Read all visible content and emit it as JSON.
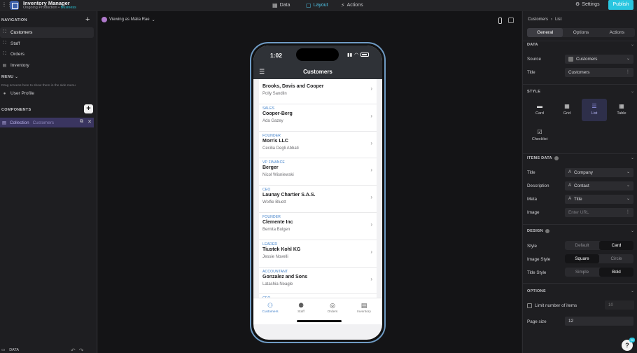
{
  "app": {
    "title": "Inventory Manager",
    "subtitle": "Ongoing Production • ",
    "plan": "Business"
  },
  "topnav": {
    "data": "Data",
    "layout": "Layout",
    "actions": "Actions",
    "settings": "Settings",
    "publish": "Publish"
  },
  "left": {
    "navigation_head": "NAVIGATION",
    "nav_items": [
      "Customers",
      "Staff",
      "Orders",
      "Inventory"
    ],
    "menu_head": "MENU",
    "menu_hint": "Drag screens here to show them in the side menu",
    "menu_items": [
      "User Profile"
    ],
    "components_head": "COMPONENTS",
    "component": {
      "name": "Collection",
      "source": "Customers"
    },
    "footer": "DATA"
  },
  "canvas": {
    "viewing_as": "Viewing as Malia Rae"
  },
  "phone": {
    "time": "1:02",
    "header_title": "Customers",
    "rows": [
      {
        "meta": "",
        "title": "Brooks, Davis and Cooper",
        "desc": "Polly Sandlin"
      },
      {
        "meta": "SALES",
        "title": "Cooper-Berg",
        "desc": "Ada Gazey"
      },
      {
        "meta": "FOUNDER",
        "title": "Morris LLC",
        "desc": "Cecilia Degli Abbati"
      },
      {
        "meta": "VP FINANCE",
        "title": "Berger",
        "desc": "Nicol Wisniewski"
      },
      {
        "meta": "CEO",
        "title": "Launay Chartier S.A.S.",
        "desc": "Wolfie Bluett"
      },
      {
        "meta": "FOUNDER",
        "title": "Clemente Inc",
        "desc": "Bernita Bulgen"
      },
      {
        "meta": "LEADER",
        "title": "Tiustek Kohl KG",
        "desc": "Jessie Novelli"
      },
      {
        "meta": "ACCOUNTANT",
        "title": "Gonzalez and Sons",
        "desc": "Latashia Neagle"
      },
      {
        "meta": "CEO",
        "title": "",
        "desc": ""
      }
    ],
    "tabs": [
      "Customers",
      "Staff",
      "Orders",
      "Inventory"
    ]
  },
  "right": {
    "crumb": [
      "Customers",
      "›",
      "List"
    ],
    "tabs": [
      "General",
      "Options",
      "Actions"
    ],
    "data_head": "DATA",
    "source_label": "Source",
    "source_value": "Customers",
    "title_label": "Title",
    "title_value": "Customers",
    "style_head": "STYLE",
    "style_options": [
      "Card",
      "Grid",
      "List",
      "Table",
      "Checklist"
    ],
    "items_head": "ITEMS DATA",
    "item_title_label": "Title",
    "item_title_value": "Company",
    "item_desc_label": "Description",
    "item_desc_value": "Contact",
    "item_meta_label": "Meta",
    "item_meta_value": "Title",
    "item_image_label": "Image",
    "item_image_placeholder": "Enter URL",
    "design_head": "DESIGN",
    "design_style_label": "Style",
    "design_style_opts": [
      "Default",
      "Card"
    ],
    "image_style_label": "Image Style",
    "image_style_opts": [
      "Square",
      "Circle"
    ],
    "title_style_label": "Title Style",
    "title_style_opts": [
      "Simple",
      "Bold"
    ],
    "options_head": "OPTIONS",
    "limit_label": "Limit number of items",
    "limit_value": "10",
    "page_size_label": "Page size",
    "page_size_value": "12",
    "help": "?",
    "help_badge": "20"
  },
  "colors": {
    "accent": "#29c6e0",
    "selection": "#3a3560",
    "phone_frame": "#6f9bc4",
    "meta_blue": "#3e7fc9"
  },
  "icons": [
    "grid-icon",
    "app-logo-icon",
    "data-icon",
    "layout-icon",
    "actions-icon",
    "gear-icon",
    "plus-icon",
    "chevron-down-icon",
    "chevron-right-icon",
    "menu-icon",
    "copy-icon",
    "close-icon",
    "undo-icon",
    "redo-icon",
    "phone-icon",
    "tablet-icon",
    "wifi-icon",
    "battery-icon",
    "info-icon",
    "help-icon"
  ]
}
